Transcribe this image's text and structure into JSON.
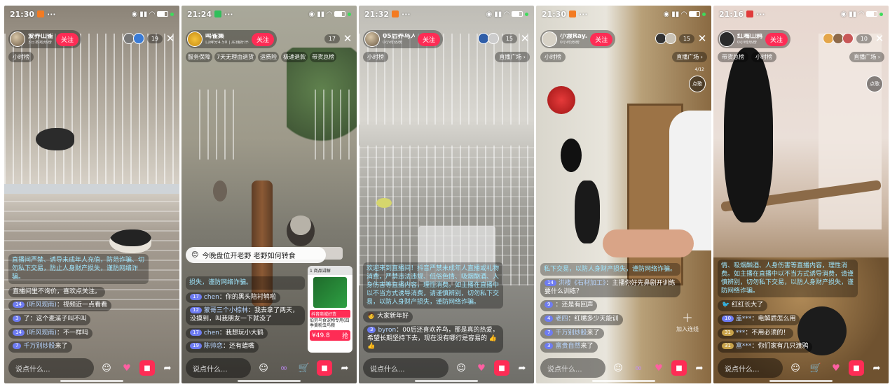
{
  "phones": [
    {
      "status_time": "21:30",
      "app_color": "#f37b22",
      "host": {
        "name": "爱养山雀",
        "sub": "3日本地热榜"
      },
      "follow_label": "关注",
      "viewers": "19",
      "chips": [
        "小时榜"
      ],
      "plaza": "",
      "notice": "直播间严禁、诱导未成年人充值，防范诈骗、切勿私下交易，防止人身财产损失，谨防网络诈骗。",
      "comments": [
        {
          "badge": "",
          "user": "",
          "text": "直播间里不询价，喜欢点关注。"
        },
        {
          "badge": "14",
          "user": "(听风观雨)",
          "text": "：视频近一点看看"
        },
        {
          "badge": "3",
          "user": "",
          "text": "了：这个麦溪子叫不叫"
        },
        {
          "badge": "14",
          "user": "(听风观雨)",
          "text": "：不一样吗"
        },
        {
          "badge": "7",
          "user": "千万别炒股",
          "text": "来了"
        }
      ],
      "say_placeholder": "说点什么..."
    },
    {
      "status_time": "21:24",
      "app_color": "#2fbf5a",
      "host": {
        "name": "鸣雀集",
        "sub": "口碑分4.50 | 店铺好评率"
      },
      "follow_label": "关注",
      "viewers": "17",
      "chips": [
        "服务保障",
        "7天无理由退货",
        "运费险",
        "极速退款",
        "带货总榜"
      ],
      "plaza": "",
      "notice": "损失，谨防网络诈骗。",
      "pinned": "今晚盘位开老野 老野如何转食",
      "comments": [
        {
          "badge": "17",
          "user": "chen",
          "text": "：你的黑头陪衬鸲啦"
        },
        {
          "badge": "12",
          "user": "蒙哥三个小棕林",
          "text": "：我去拿了两天，没摸到，叫我朋友一下就没了"
        },
        {
          "badge": "17",
          "user": "chen",
          "text": "：我想玩小大鹤"
        },
        {
          "badge": "19",
          "user": "陈帅恋",
          "text": "：还有蜡嘴"
        }
      ],
      "product": {
        "head": "1 商品讲解",
        "tag": "抖音商城好货",
        "desc": "伯劳鸟食宠物专用(四季黄粉虫鸟粮",
        "price": "¥49.8",
        "buy": "抢"
      },
      "say_placeholder": "说点什么..."
    },
    {
      "status_time": "21:32",
      "app_color": "#f37b22",
      "host": {
        "name": "05后养鸟人",
        "sub": "0小时热榜"
      },
      "follow_label": "关注",
      "viewers": "15",
      "chips": [
        "小时榜"
      ],
      "plaza": "直播广场",
      "notice": "欢迎来到直播间！抖音严禁未成年人直播或礼物消费，严禁违法违规、低俗色情、吸烟酗酒、人身伤害等直播内容，理性消费。如主播在直播中以不当方式诱导消费，请谨慎辨别，切勿私下交易，以防人身财产损失，谨防网络诈骗。",
      "comments": [
        {
          "badge": "",
          "user": "",
          "text": "大家新年好"
        },
        {
          "badge": "3",
          "user": "byron",
          "text": "：00后还喜欢养鸟，那是真的热爱，希望长期坚持下去，现在没有哪行是容易的 👍👍"
        }
      ],
      "say_placeholder": "说点什么..."
    },
    {
      "status_time": "21:30",
      "app_color": "#f37b22",
      "host": {
        "name": "小渡Ray.",
        "sub": "0小时热榜"
      },
      "follow_label": "关注",
      "viewers": "15",
      "chips": [
        "小时榜"
      ],
      "plaza": "直播广场",
      "album_label": "4/12",
      "dianke": "点歌",
      "notice": "私下交易，以防人身财产损失，谨防网络诈骗。",
      "comments": [
        {
          "badge": "14",
          "user": "洪楼《石材加工》",
          "text": "：主播你好先鼻剧开训练要什么训练？"
        },
        {
          "badge": "9",
          "user": "",
          "text": "：还是有回声"
        },
        {
          "badge": "4",
          "user": "老四",
          "text": "：红嘴多少天能训"
        },
        {
          "badge": "7",
          "user": "千万别炒股",
          "text": "来了"
        },
        {
          "badge": "3",
          "user": "富贵自然",
          "text": "来了"
        }
      ],
      "addlive": "加入连线",
      "say_placeholder": "说点什么..."
    },
    {
      "status_time": "21:16",
      "app_color": "#e03a3a",
      "host": {
        "name": "红嘴山鸦",
        "sub": "0小时热榜"
      },
      "follow_label": "关注",
      "viewers": "10",
      "chips": [
        "带货总榜",
        "小时榜"
      ],
      "plaza": "直播广场",
      "dianke": "点歌",
      "notice": "情、吸烟酗酒、人身伤害等直播内容，理性消费。如主播在直播中以不当方式诱导消费，请谨慎辨别，切勿私下交易，以防人身财产损失，谨防网络诈骗。",
      "comments": [
        {
          "badge": "",
          "user": "",
          "text": "红红长大了"
        },
        {
          "badge": "10",
          "user": "盖***",
          "text": "：电解质怎么用"
        },
        {
          "badge": "31",
          "user": "***",
          "text": "：不用必须的！"
        },
        {
          "badge": "31",
          "user": "富***",
          "text": "：你们家有几只渡鸦"
        }
      ],
      "say_placeholder": "说点什么..."
    }
  ],
  "colors": {
    "follow": "#fe2c55",
    "notice": "#9fe7ff",
    "badge": "#6e7cf2"
  }
}
